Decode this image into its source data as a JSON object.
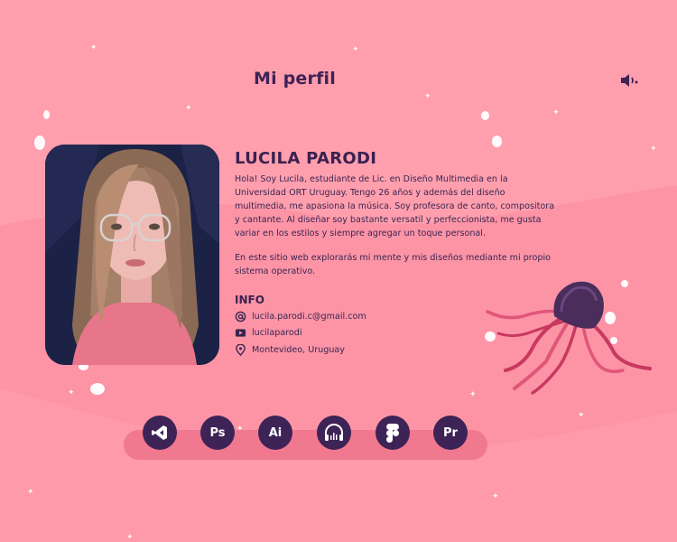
{
  "header": {
    "title": "Mi perfil"
  },
  "profile": {
    "name": "LUCILA PARODI",
    "bio_paragraph_1": "Hola! Soy Lucila, estudiante de Lic. en Diseño Multimedia en la Universidad ORT Uruguay. Tengo 26 años y además del diseño multimedia, me apasiona la música. Soy profesora de canto, compositora y cantante. Al diseñar soy bastante versatil y perfeccionista, me gusta variar en los estilos y siempre agregar un toque personal.",
    "bio_paragraph_2": "En este sitio web explorarás mi mente y mis diseños mediante mi propio sistema operativo."
  },
  "info": {
    "title": "INFO",
    "email": "lucila.parodi.c@gmail.com",
    "youtube": "lucilaparodi",
    "location": "Montevideo, Uruguay"
  },
  "dock": {
    "apps": [
      {
        "label": "",
        "icon": "visual-studio-icon"
      },
      {
        "label": "Ps",
        "icon": "photoshop-icon"
      },
      {
        "label": "Ai",
        "icon": "illustrator-icon"
      },
      {
        "label": "",
        "icon": "audio-headphones-icon"
      },
      {
        "label": "",
        "icon": "figma-icon"
      },
      {
        "label": "Pr",
        "icon": "premiere-icon"
      }
    ]
  },
  "colors": {
    "background": "#ff9fad",
    "accent_dark": "#3d2356",
    "dock": "#f0788f",
    "jellyfish": "#c8385f"
  }
}
